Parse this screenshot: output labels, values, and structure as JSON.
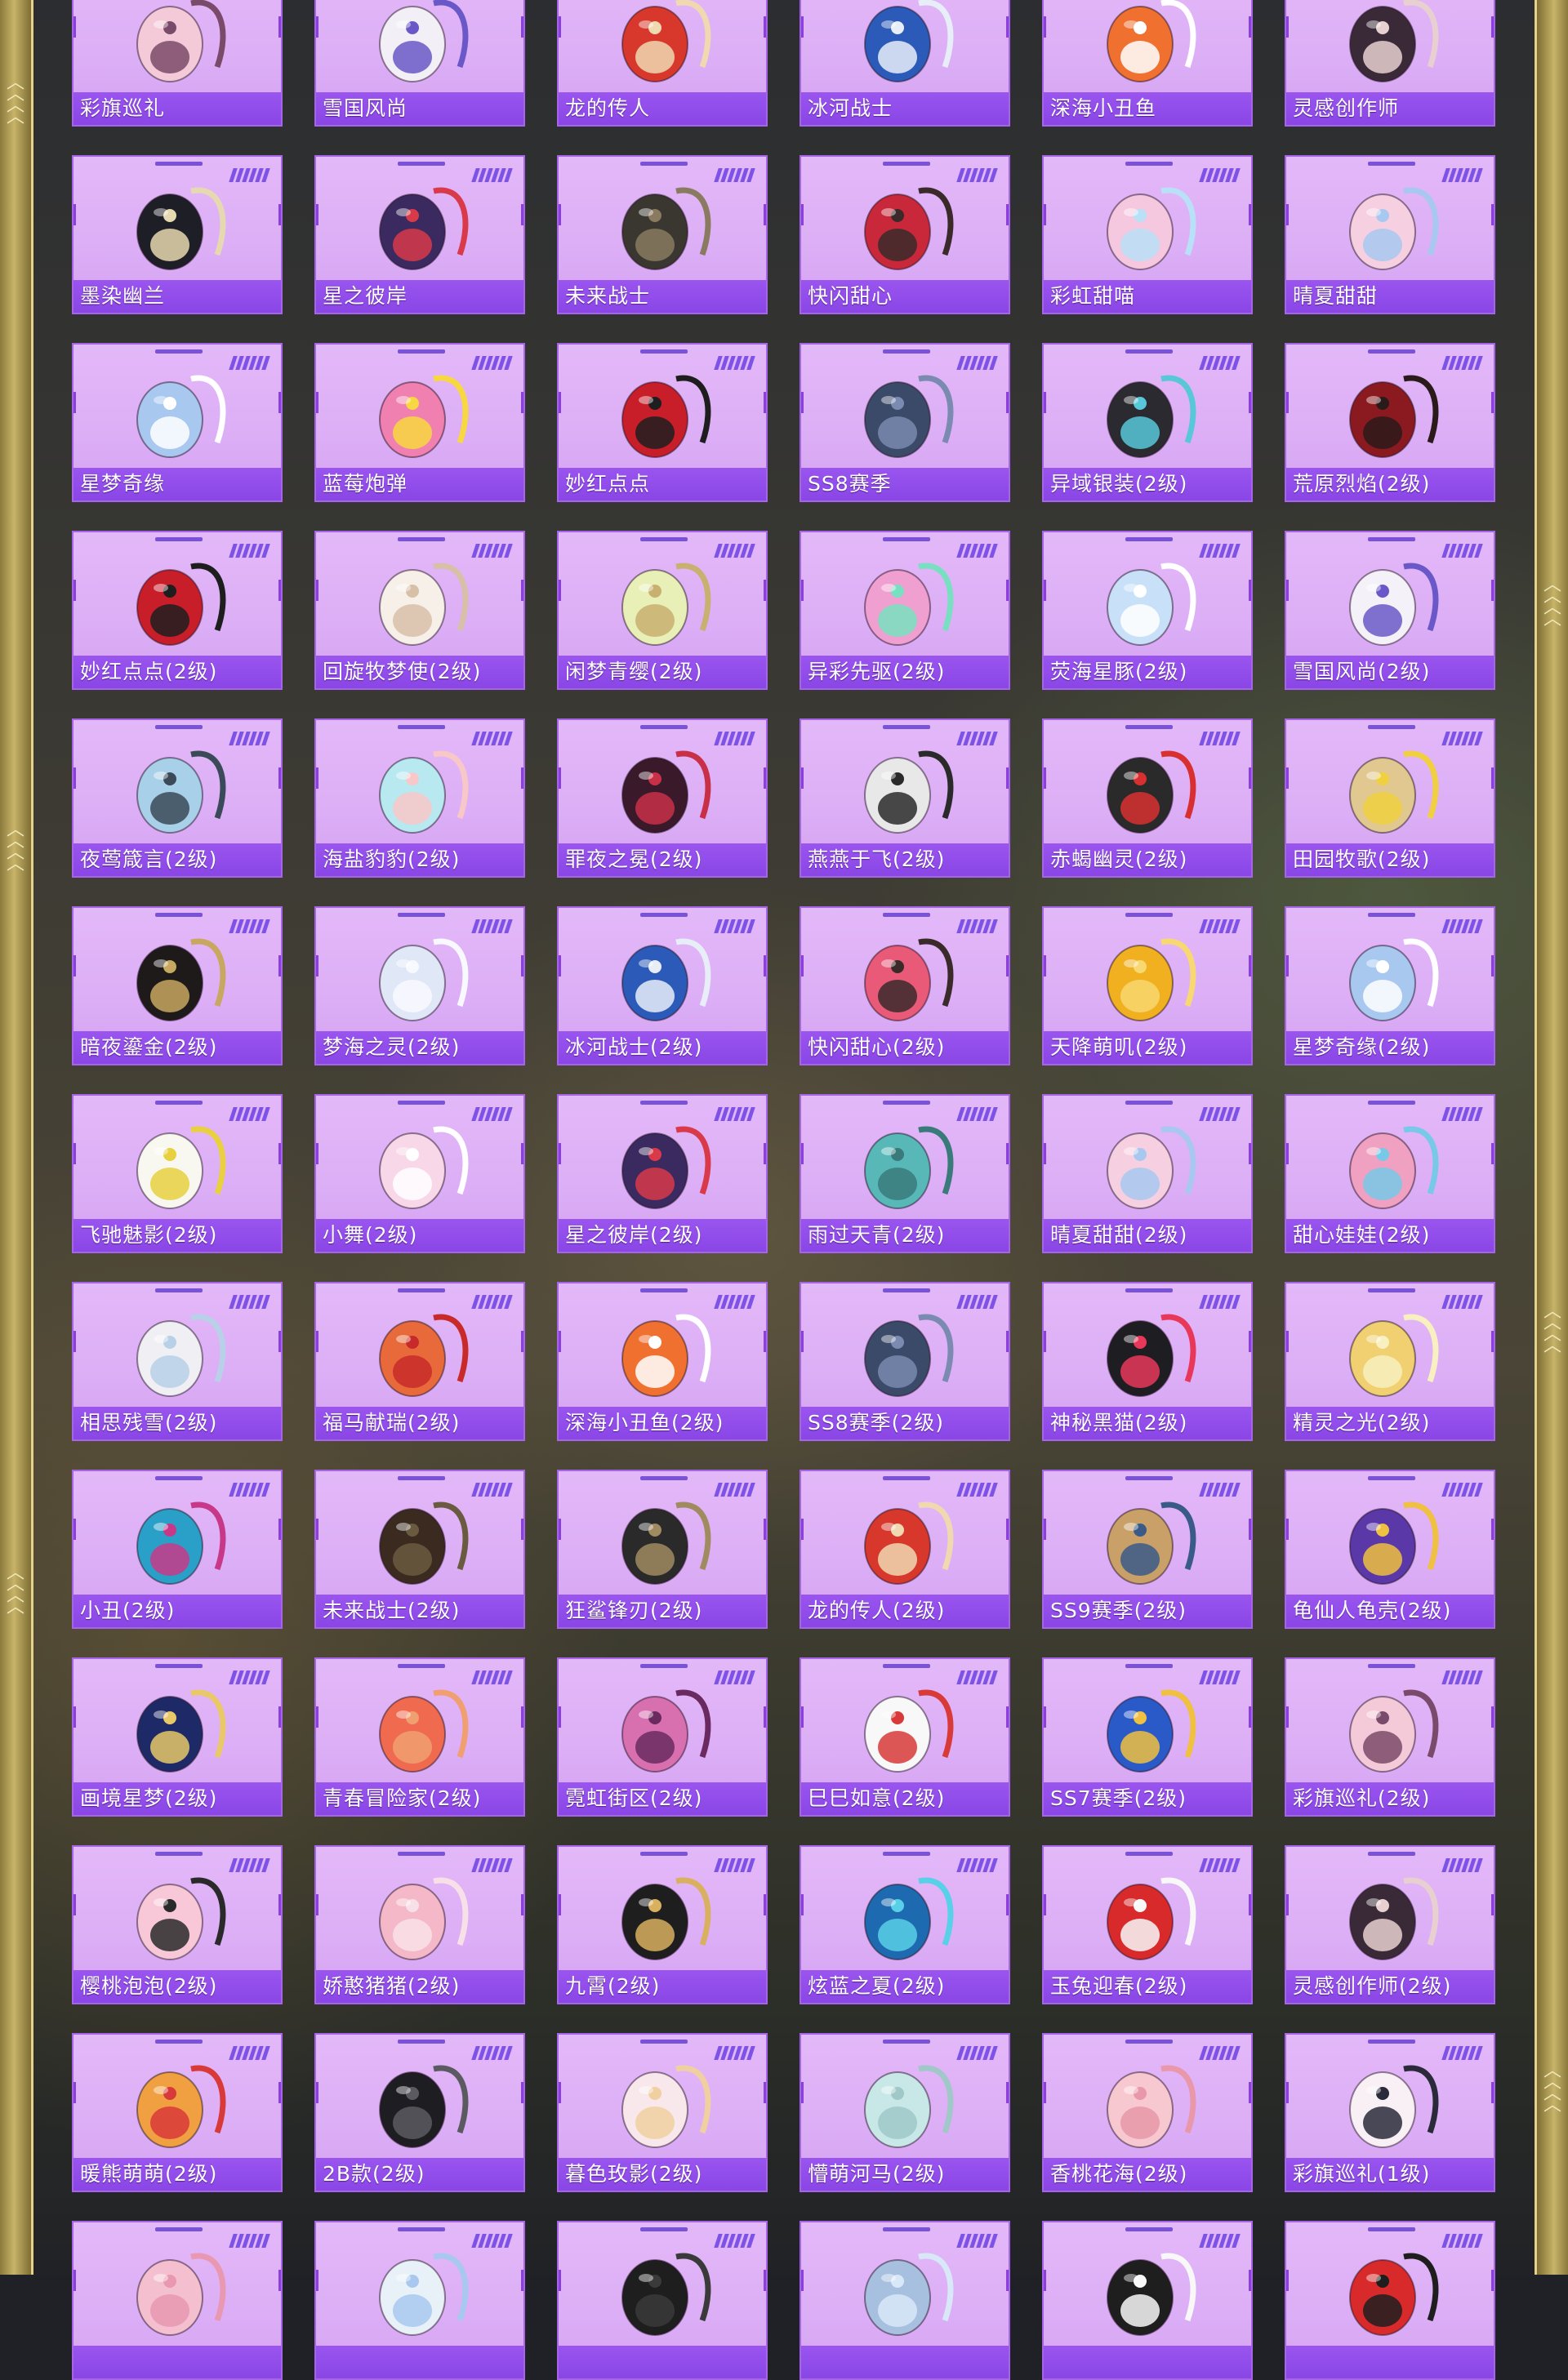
{
  "colors": {
    "card_bg": "#dcaef6",
    "name_bar": "#8f4ae9",
    "accent": "#7c53e6",
    "frame": "#c7b468"
  },
  "items": [
    {
      "name": "彩旗巡礼",
      "icon": "backpack-icon",
      "c1": "#f4c9d8",
      "c2": "#7a4a6a"
    },
    {
      "name": "雪国风尚",
      "icon": "backpack-icon",
      "c1": "#f2f0f6",
      "c2": "#6a58c8"
    },
    {
      "name": "龙的传人",
      "icon": "backpack-icon",
      "c1": "#d8382c",
      "c2": "#f0d8b0"
    },
    {
      "name": "冰河战士",
      "icon": "backpack-icon",
      "c1": "#2c5ab8",
      "c2": "#e8eef8"
    },
    {
      "name": "深海小丑鱼",
      "icon": "backpack-icon",
      "c1": "#f07030",
      "c2": "#ffffff"
    },
    {
      "name": "灵感创作师",
      "icon": "backpack-icon",
      "c1": "#3a2a38",
      "c2": "#e8d0d0"
    },
    {
      "name": "墨染幽兰",
      "icon": "backpack-icon",
      "c1": "#1e1e26",
      "c2": "#e6d8b0"
    },
    {
      "name": "星之彼岸",
      "icon": "backpack-icon",
      "c1": "#3a2a60",
      "c2": "#d83a4a"
    },
    {
      "name": "未来战士",
      "icon": "backpack-icon",
      "c1": "#3a3630",
      "c2": "#8a7a60"
    },
    {
      "name": "快闪甜心",
      "icon": "backpack-icon",
      "c1": "#c8283a",
      "c2": "#3a2a2a"
    },
    {
      "name": "彩虹甜喵",
      "icon": "backpack-icon",
      "c1": "#f6c8e0",
      "c2": "#b8e0f6"
    },
    {
      "name": "晴夏甜甜",
      "icon": "backpack-icon",
      "c1": "#f6d0e0",
      "c2": "#a8c8f0"
    },
    {
      "name": "星梦奇缘",
      "icon": "backpack-icon",
      "c1": "#a8c8f0",
      "c2": "#ffffff"
    },
    {
      "name": "蓝莓炮弹",
      "icon": "backpack-icon",
      "c1": "#f080b0",
      "c2": "#f8d840"
    },
    {
      "name": "妙红点点",
      "icon": "backpack-icon",
      "c1": "#c81e2a",
      "c2": "#1e1e1e"
    },
    {
      "name": "SS8赛季",
      "icon": "backpack-icon",
      "c1": "#3a4a68",
      "c2": "#7a8ab0"
    },
    {
      "name": "异域银装(2级)",
      "icon": "backpack-icon",
      "c1": "#2a2a30",
      "c2": "#58c8d8"
    },
    {
      "name": "荒原烈焰(2级)",
      "icon": "backpack-icon",
      "c1": "#8a1a20",
      "c2": "#2a1a1a"
    },
    {
      "name": "妙红点点(2级)",
      "icon": "backpack-icon",
      "c1": "#c81e2a",
      "c2": "#1e1e1e"
    },
    {
      "name": "回旋牧梦使(2级)",
      "icon": "backpack-icon",
      "c1": "#f6f0e8",
      "c2": "#d8c0a8"
    },
    {
      "name": "闲梦青缨(2级)",
      "icon": "backpack-icon",
      "c1": "#e8f0b8",
      "c2": "#c8b070"
    },
    {
      "name": "异彩先驱(2级)",
      "icon": "backpack-icon",
      "c1": "#f0a0d0",
      "c2": "#78e0c0"
    },
    {
      "name": "荧海星豚(2级)",
      "icon": "backpack-icon",
      "c1": "#c8e0f8",
      "c2": "#ffffff"
    },
    {
      "name": "雪国风尚(2级)",
      "icon": "backpack-icon",
      "c1": "#f4f2f8",
      "c2": "#6a58c8"
    },
    {
      "name": "夜莺箴言(2级)",
      "icon": "backpack-icon",
      "c1": "#a8d0e8",
      "c2": "#3a4a58"
    },
    {
      "name": "海盐豹豹(2级)",
      "icon": "backpack-icon",
      "c1": "#b8e8f0",
      "c2": "#f8c8c8"
    },
    {
      "name": "罪夜之冕(2级)",
      "icon": "backpack-icon",
      "c1": "#3a1a2a",
      "c2": "#c83048"
    },
    {
      "name": "燕燕于飞(2级)",
      "icon": "backpack-icon",
      "c1": "#e8e8e8",
      "c2": "#2a2a2a"
    },
    {
      "name": "赤蝎幽灵(2级)",
      "icon": "backpack-icon",
      "c1": "#2a2a2a",
      "c2": "#d83030"
    },
    {
      "name": "田园牧歌(2级)",
      "icon": "backpack-icon",
      "c1": "#e0c890",
      "c2": "#f0d040"
    },
    {
      "name": "暗夜鎏金(2级)",
      "icon": "backpack-icon",
      "c1": "#1e1a1a",
      "c2": "#c8a860"
    },
    {
      "name": "梦海之灵(2级)",
      "icon": "backpack-icon",
      "c1": "#e0e8f8",
      "c2": "#f8f8ff"
    },
    {
      "name": "冰河战士(2级)",
      "icon": "backpack-icon",
      "c1": "#2c5ab8",
      "c2": "#e8eef8"
    },
    {
      "name": "快闪甜心(2级)",
      "icon": "backpack-icon",
      "c1": "#e85a78",
      "c2": "#3a2a2a"
    },
    {
      "name": "天降萌叽(2级)",
      "icon": "backpack-icon",
      "c1": "#f0b020",
      "c2": "#f8d870"
    },
    {
      "name": "星梦奇缘(2级)",
      "icon": "backpack-icon",
      "c1": "#a8c8f0",
      "c2": "#ffffff"
    },
    {
      "name": "飞驰魅影(2级)",
      "icon": "backpack-icon",
      "c1": "#f8f8f0",
      "c2": "#e8d040"
    },
    {
      "name": "小舞(2级)",
      "icon": "backpack-icon",
      "c1": "#f8d8e8",
      "c2": "#ffffff"
    },
    {
      "name": "星之彼岸(2级)",
      "icon": "backpack-icon",
      "c1": "#3a2a60",
      "c2": "#d83a4a"
    },
    {
      "name": "雨过天青(2级)",
      "icon": "backpack-icon",
      "c1": "#58b8b8",
      "c2": "#3a7a7a"
    },
    {
      "name": "晴夏甜甜(2级)",
      "icon": "backpack-icon",
      "c1": "#f6d0e0",
      "c2": "#a8c8f0"
    },
    {
      "name": "甜心娃娃(2级)",
      "icon": "backpack-icon",
      "c1": "#f0a0c0",
      "c2": "#78c8e8"
    },
    {
      "name": "相思残雪(2级)",
      "icon": "backpack-icon",
      "c1": "#f0f0f4",
      "c2": "#b8d0e8"
    },
    {
      "name": "福马献瑞(2级)",
      "icon": "backpack-icon",
      "c1": "#e86a3a",
      "c2": "#c82a2a"
    },
    {
      "name": "深海小丑鱼(2级)",
      "icon": "backpack-icon",
      "c1": "#f07030",
      "c2": "#ffffff"
    },
    {
      "name": "SS8赛季(2级)",
      "icon": "backpack-icon",
      "c1": "#3a4a68",
      "c2": "#7a8ab0"
    },
    {
      "name": "神秘黑猫(2级)",
      "icon": "backpack-icon",
      "c1": "#1e1e22",
      "c2": "#e8385a"
    },
    {
      "name": "精灵之光(2级)",
      "icon": "backpack-icon",
      "c1": "#f0d070",
      "c2": "#f8f0c0"
    },
    {
      "name": "小丑(2级)",
      "icon": "backpack-icon",
      "c1": "#2aa0c8",
      "c2": "#c83888"
    },
    {
      "name": "未来战士(2级)",
      "icon": "backpack-icon",
      "c1": "#3a2a20",
      "c2": "#6a5a40"
    },
    {
      "name": "狂鲨锋刃(2级)",
      "icon": "backpack-icon",
      "c1": "#2a2a2a",
      "c2": "#a08a60"
    },
    {
      "name": "龙的传人(2级)",
      "icon": "backpack-icon",
      "c1": "#d8382c",
      "c2": "#f0d8b0"
    },
    {
      "name": "SS9赛季(2级)",
      "icon": "backpack-icon",
      "c1": "#c8a068",
      "c2": "#3a5a88"
    },
    {
      "name": "龟仙人龟壳(2级)",
      "icon": "backpack-icon",
      "c1": "#5a38a8",
      "c2": "#f0c040"
    },
    {
      "name": "画境星梦(2级)",
      "icon": "backpack-icon",
      "c1": "#1e2a68",
      "c2": "#e8c868"
    },
    {
      "name": "青春冒险家(2级)",
      "icon": "backpack-icon",
      "c1": "#f06a50",
      "c2": "#f0a070"
    },
    {
      "name": "霓虹街区(2级)",
      "icon": "backpack-icon",
      "c1": "#d870b0",
      "c2": "#6a2a60"
    },
    {
      "name": "巳巳如意(2级)",
      "icon": "backpack-icon",
      "c1": "#f8f8f8",
      "c2": "#d83a3a"
    },
    {
      "name": "SS7赛季(2级)",
      "icon": "backpack-icon",
      "c1": "#2a5ac8",
      "c2": "#f0c040"
    },
    {
      "name": "彩旗巡礼(2级)",
      "icon": "backpack-icon",
      "c1": "#f4c9d8",
      "c2": "#7a4a6a"
    },
    {
      "name": "樱桃泡泡(2级)",
      "icon": "backpack-icon",
      "c1": "#f8c8d8",
      "c2": "#2a2a2a"
    },
    {
      "name": "娇憨猪猪(2级)",
      "icon": "backpack-icon",
      "c1": "#f4b8c8",
      "c2": "#f8e0e8"
    },
    {
      "name": "九霄(2级)",
      "icon": "backpack-icon",
      "c1": "#1e1e1e",
      "c2": "#d8b060"
    },
    {
      "name": "炫蓝之夏(2级)",
      "icon": "backpack-icon",
      "c1": "#1e6ab0",
      "c2": "#58d0e8"
    },
    {
      "name": "玉兔迎春(2级)",
      "icon": "backpack-icon",
      "c1": "#d82a2a",
      "c2": "#f8f8f8"
    },
    {
      "name": "灵感创作师(2级)",
      "icon": "backpack-icon",
      "c1": "#3a2a38",
      "c2": "#e8d0d0"
    },
    {
      "name": "暖熊萌萌(2级)",
      "icon": "backpack-icon",
      "c1": "#f0a040",
      "c2": "#d83a3a"
    },
    {
      "name": "2B款(2级)",
      "icon": "backpack-icon",
      "c1": "#1e1e22",
      "c2": "#5a5a60"
    },
    {
      "name": "暮色玫影(2级)",
      "icon": "backpack-icon",
      "c1": "#f8e8ec",
      "c2": "#f0d0a0"
    },
    {
      "name": "懵萌河马(2级)",
      "icon": "backpack-icon",
      "c1": "#c8e8e8",
      "c2": "#a0c8c8"
    },
    {
      "name": "香桃花海(2级)",
      "icon": "backpack-icon",
      "c1": "#f8c8d0",
      "c2": "#e898a8"
    },
    {
      "name": "彩旗巡礼(1级)",
      "icon": "backpack-icon",
      "c1": "#f8f0f4",
      "c2": "#2a2a3a"
    },
    {
      "name": "",
      "icon": "backpack-icon",
      "c1": "#f4c0d0",
      "c2": "#e898b0"
    },
    {
      "name": "",
      "icon": "backpack-icon",
      "c1": "#e8f0f8",
      "c2": "#a8c8f0"
    },
    {
      "name": "",
      "icon": "backpack-icon",
      "c1": "#1e1e1e",
      "c2": "#3a3a3a"
    },
    {
      "name": "",
      "icon": "backpack-icon",
      "c1": "#a8c0e0",
      "c2": "#d8e8f8"
    },
    {
      "name": "",
      "icon": "backpack-icon",
      "c1": "#1e1e1e",
      "c2": "#f8f8f8"
    },
    {
      "name": "",
      "icon": "backpack-icon",
      "c1": "#d82a2a",
      "c2": "#1e1e1e"
    }
  ]
}
